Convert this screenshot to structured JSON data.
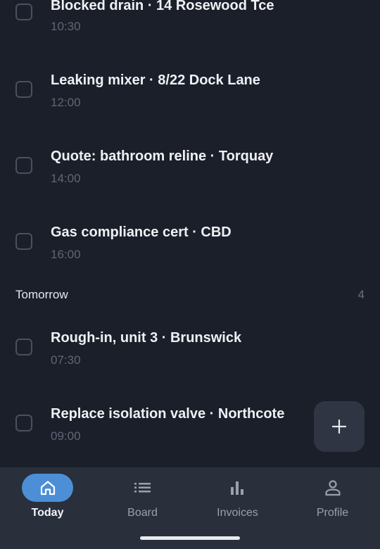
{
  "sections": [
    {
      "tasks": [
        {
          "title": "Blocked drain · 14 Rosewood Tce",
          "time": "10:30"
        },
        {
          "title": "Leaking mixer · 8/22 Dock Lane",
          "time": "12:00"
        },
        {
          "title": "Quote: bathroom reline · Torquay",
          "time": "14:00"
        },
        {
          "title": "Gas compliance cert · CBD",
          "time": "16:00"
        }
      ]
    },
    {
      "title": "Tomorrow",
      "count": "4",
      "tasks": [
        {
          "title": "Rough-in, unit 3 · Brunswick",
          "time": "07:30"
        },
        {
          "title": "Replace isolation valve · Northcote",
          "time": "09:00"
        }
      ]
    }
  ],
  "fab": {
    "icon": "plus-icon"
  },
  "nav": {
    "items": [
      {
        "label": "Today",
        "icon": "home-icon",
        "active": true
      },
      {
        "label": "Board",
        "icon": "list-icon",
        "active": false
      },
      {
        "label": "Invoices",
        "icon": "bar-chart-icon",
        "active": false
      },
      {
        "label": "Profile",
        "icon": "person-icon",
        "active": false
      }
    ]
  },
  "colors": {
    "background": "#1b1f29",
    "nav_background": "#2a2f3c",
    "accent": "#4d8fd6"
  }
}
